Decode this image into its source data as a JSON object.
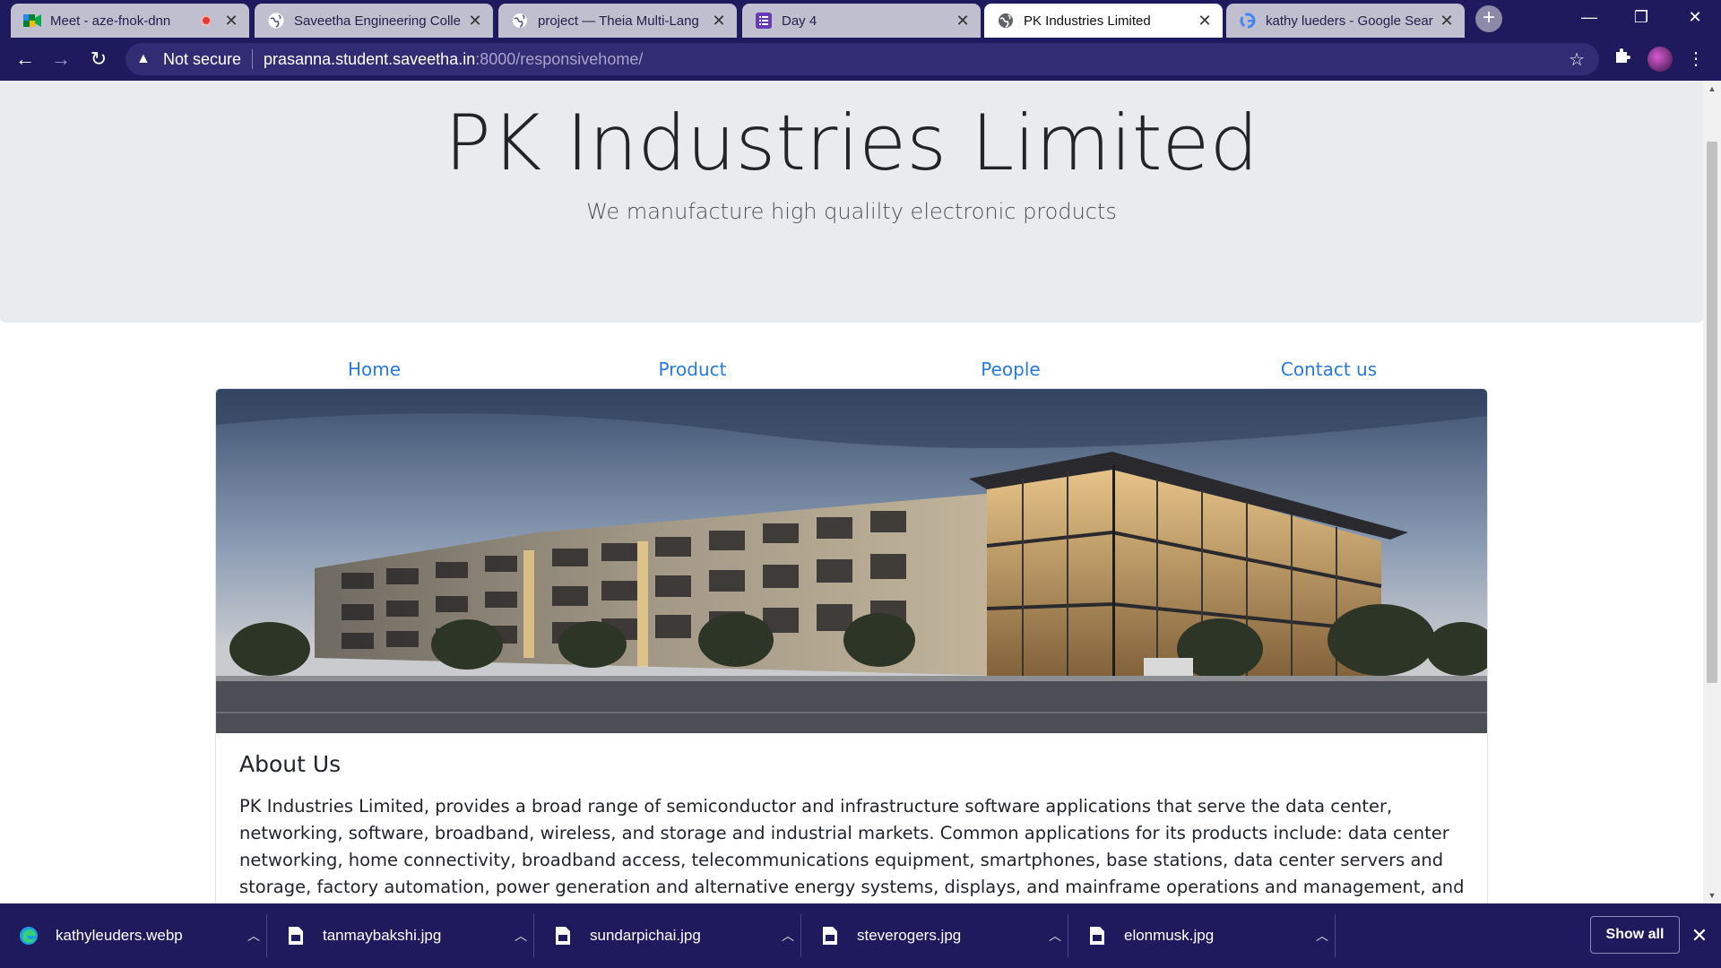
{
  "browser": {
    "tabs": [
      {
        "title": "Meet - aze-fnok-dnn",
        "icon": "google-meet-icon",
        "recording": true,
        "active": false
      },
      {
        "title": "Saveetha Engineering Colle",
        "icon": "globe-icon",
        "active": false
      },
      {
        "title": "project — Theia Multi-Lang",
        "icon": "globe-icon",
        "active": false
      },
      {
        "title": "Day 4",
        "icon": "form-list-icon",
        "active": false
      },
      {
        "title": "PK Industries Limited",
        "icon": "globe-icon",
        "active": true
      },
      {
        "title": "kathy lueders - Google Sear",
        "icon": "google-icon",
        "active": false
      }
    ],
    "security_label": "Not secure",
    "url_host": "prasanna.student.saveetha.in",
    "url_path": ":8000/responsivehome/"
  },
  "page": {
    "title": "PK Industries Limited",
    "tagline": "We manufacture high qualilty electronic products",
    "nav": [
      "Home",
      "Product",
      "People",
      "Contact us"
    ],
    "about_heading": "About Us",
    "about_text": "PK Industries Limited, provides a broad range of semiconductor and infrastructure software applications that serve the data center, networking, software, broadband, wireless, and storage and industrial markets. Common applications for its products include: data center networking, home connectivity, broadband access, telecommunications equipment, smartphones, base stations, data center servers and storage, factory automation, power generation and alternative energy systems, displays, and mainframe operations and management, and application software development. Some"
  },
  "downloads": {
    "files": [
      "kathyleuders.webp",
      "tanmaybakshi.jpg",
      "sundarpichai.jpg",
      "steverogers.jpg",
      "elonmusk.jpg"
    ],
    "show_all_label": "Show all"
  },
  "colors": {
    "chrome": "#1f1a5e",
    "link": "#2579e0",
    "jumbotron": "#e9ecef"
  }
}
